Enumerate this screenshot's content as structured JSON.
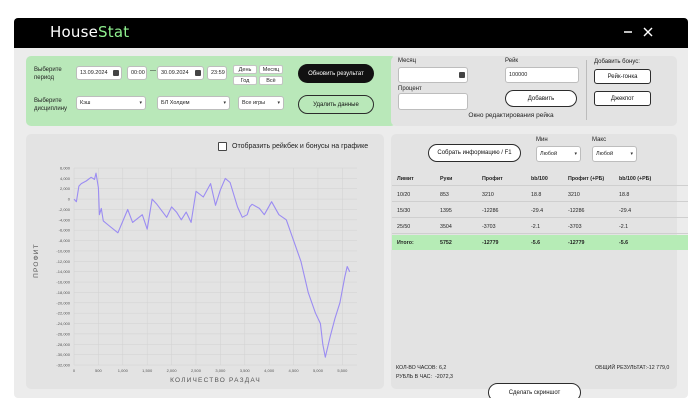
{
  "app": {
    "title_a": "House",
    "title_b": "Stat"
  },
  "filters": {
    "period_label": "Выберите период",
    "date_from": "13.09.2024",
    "time_from": "00:00",
    "dash": "—",
    "date_to": "30.09.2024",
    "time_to": "23:59",
    "quick": [
      "День",
      "Месяц",
      "Год",
      "Всё"
    ],
    "discipline_label": "Выберите дисциплину",
    "discipline": "Кэш",
    "limit": "БЛ Холдем",
    "games": "Все игры",
    "update_btn": "Обновить результат",
    "delete_btn": "Удалить данные"
  },
  "editor": {
    "month_label": "Месяц",
    "rake_label": "Рейк",
    "rake_value": "100000",
    "percent_label": "Процент",
    "add_btn": "Добавить",
    "caption": "Окно редактирования рейка",
    "bonus_label": "Добавить бонус:",
    "rake_race_btn": "Рейк-гонка",
    "jackpot_btn": "Джекпот"
  },
  "chart_panel": {
    "toggle_label": "Отобразить рейкбек и бонусы на графике"
  },
  "stats": {
    "collect_btn": "Собрать информацию / F1",
    "min_label": "Мин",
    "max_label": "Макс",
    "min_value": "Любой",
    "max_value": "Любой",
    "columns": [
      "Лимит",
      "Руки",
      "Профит",
      "bb/100",
      "Профит (+РБ)",
      "bb/100 (+РБ)"
    ],
    "rows": [
      [
        "10/20",
        "853",
        "3210",
        "18.8",
        "3210",
        "18.8"
      ],
      [
        "15/30",
        "1395",
        "-12286",
        "-29.4",
        "-12286",
        "-29.4"
      ],
      [
        "25/50",
        "3504",
        "-3703",
        "-2.1",
        "-3703",
        "-2.1"
      ]
    ],
    "total": [
      "Итого:",
      "5752",
      "-12779",
      "-5.6",
      "-12779",
      "-5.6"
    ],
    "hours_label": "КОЛ-ВО ЧАСОВ:",
    "hours_value": "6,2",
    "rub_label": "РУБЛЬ В ЧАС:",
    "rub_value": "-2072,3",
    "overall_label": "ОБЩИЙ РЕЗУЛЬТАТ:",
    "overall_value": "-12 779,0",
    "screenshot_btn": "Сделать скриншот"
  },
  "chart_data": {
    "type": "line",
    "xlabel": "КОЛИЧЕСТВО РАЗДАЧ",
    "ylabel": "ПРОФИТ",
    "xlim": [
      0,
      5800
    ],
    "ylim": [
      -32000,
      6000
    ],
    "x_ticks": [
      "0",
      "500",
      "1,000",
      "1,500",
      "2,000",
      "2,500",
      "3,000",
      "3,500",
      "4,000",
      "4,500",
      "5,000",
      "5,500"
    ],
    "y_ticks": [
      "6,000",
      "4,000",
      "2,000",
      "0",
      "-2,000",
      "-4,000",
      "-6,000",
      "-8,000",
      "-10,000",
      "-12,000",
      "-14,000",
      "-16,000",
      "-18,000",
      "-20,000",
      "-22,000",
      "-24,000",
      "-26,000",
      "-28,000",
      "-30,000",
      "-32,000"
    ],
    "grid": true,
    "color": "#9b8cf2",
    "series": [
      {
        "x": [
          0,
          50,
          100,
          150,
          250,
          350,
          420,
          450,
          500,
          520,
          560,
          600,
          700,
          900,
          1100,
          1200,
          1400,
          1500,
          1600,
          1700,
          1900,
          2000,
          2100,
          2200,
          2300,
          2400,
          2500,
          2650,
          2800,
          2900,
          3000,
          3100,
          3200,
          3350,
          3450,
          3550,
          3600,
          3650,
          3800,
          3900,
          4050,
          4200,
          4350,
          4500,
          4650,
          4800,
          4950,
          5050,
          5100,
          5150,
          5250,
          5350,
          5450,
          5550,
          5600,
          5650
        ],
        "y": [
          0,
          -500,
          2500,
          3000,
          3500,
          4200,
          3800,
          5000,
          2200,
          -3000,
          -1800,
          -4200,
          -5000,
          -6500,
          -2000,
          -4500,
          -3000,
          -5800,
          0,
          -1000,
          -3500,
          -1500,
          -2500,
          -4000,
          -2500,
          -4500,
          1500,
          400,
          3000,
          -1200,
          1800,
          4000,
          3200,
          -1500,
          -3500,
          -3000,
          -1500,
          -1000,
          -1800,
          -3000,
          -500,
          -3000,
          -4000,
          -8000,
          -12000,
          -18000,
          -22000,
          -24000,
          -28000,
          -30500,
          -26500,
          -23000,
          -20000,
          -15000,
          -13000,
          -14000
        ]
      }
    ]
  }
}
